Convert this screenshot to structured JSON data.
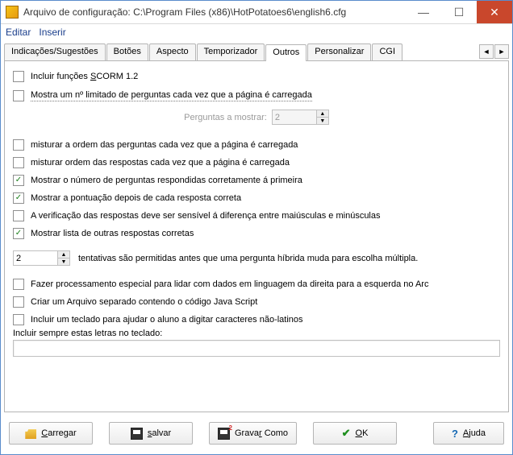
{
  "window": {
    "title": "Arquivo de configuração: C:\\Program Files (x86)\\HotPotatoes6\\english6.cfg"
  },
  "menu": {
    "edit": "Editar",
    "insert": "Inserir"
  },
  "tabs": {
    "t1": "Indicações/Sugestões",
    "t2": "Botões",
    "t3": "Aspecto",
    "t4": "Temporizador",
    "t5": "Outros",
    "t6": "Personalizar",
    "t7": "CGI"
  },
  "opts": {
    "scorm": "Incluir funções SCORM 1.2",
    "limit": "Mostra um nº limitado de perguntas cada vez que a página é carregada",
    "questionsLabel": "Perguntas a mostrar:",
    "questionsValue": "2",
    "shuffleQ": "misturar a ordem das perguntas cada vez que a página é carregada",
    "shuffleA": "misturar ordem das respostas cada vez que a página é carregada",
    "showCount": "Mostrar o  número de perguntas respondidas corretamente á primeira",
    "showScore": "Mostrar a pontuação depois de cada resposta correta",
    "caseSensitive": "A verificação das respostas deve ser sensível á diferença entre maiúsculas e minúsculas",
    "showOther": "Mostrar lista de outras respostas corretas",
    "attemptsValue": "2",
    "attemptsText": "tentativas são permitidas antes que uma pergunta híbrida muda para escolha múltipla.",
    "rtl": "Fazer processamento especial para lidar com dados em linguagem da direita para a esquerda no Arc",
    "sepJs": "Criar um Arquivo separado contendo o código Java Script",
    "keyboard": "Incluir um teclado para ajudar o aluno a digitar caracteres não-latinos",
    "keyboardLabel": "Incluir sempre estas letras no teclado:",
    "keyboardValue": ""
  },
  "btns": {
    "load_pre": "C",
    "load_rest": "arregar",
    "save_pre": "",
    "save_u": "s",
    "save_rest": "alvar",
    "saveas_pre": "Grava",
    "saveas_u": "r",
    "saveas_rest": " Como",
    "ok_u": "O",
    "ok_rest": "K",
    "help_u": "A",
    "help_rest": "juda"
  }
}
